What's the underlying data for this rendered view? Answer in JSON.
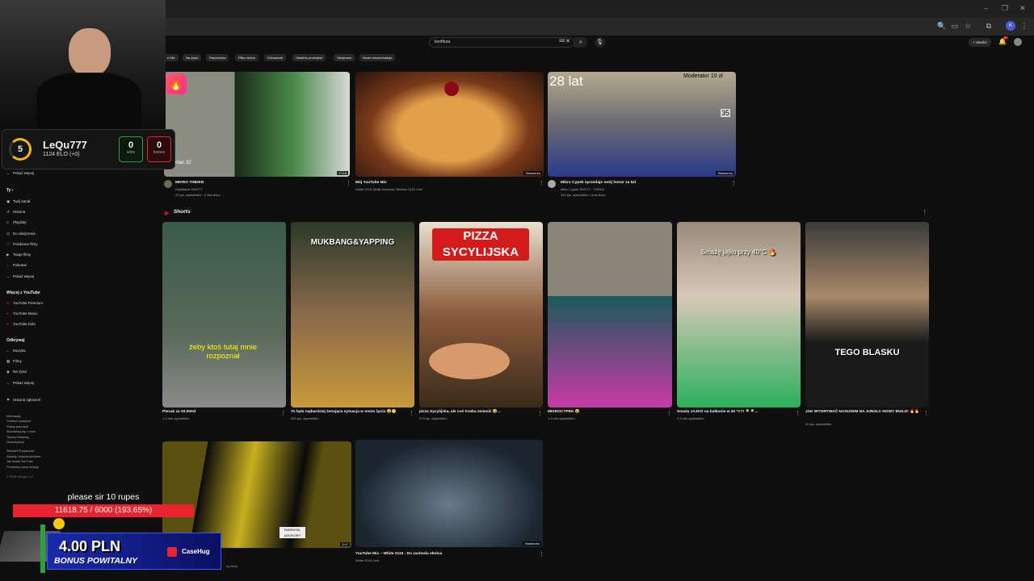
{
  "browser": {
    "title": "",
    "minimize": "–",
    "restore": "❐",
    "close": "✕",
    "profile_initial": "K"
  },
  "header": {
    "search_value": "konfitura",
    "create_label": "+ Utwórz",
    "notif_badge": "9+"
  },
  "chips": [
    "e Mix",
    "Na żywo",
    "Reprezenia",
    "Piłka nożna",
    "Gotowanie",
    "Ostatnio przesłane",
    "Obejrzane",
    "Nowe rekomendacje"
  ],
  "sidebar": {
    "show_more_1": "Pokaż więcej",
    "you_heading": "Ty  ›",
    "you_items": [
      {
        "icon": "▣",
        "label": "Twój kanał"
      },
      {
        "icon": "↺",
        "label": "Historia"
      },
      {
        "icon": "≡",
        "label": "Playlisty"
      },
      {
        "icon": "◷",
        "label": "Do obejrzenia"
      },
      {
        "icon": "♡",
        "label": "Polubione filmy"
      },
      {
        "icon": "▶",
        "label": "Twoje filmy"
      },
      {
        "icon": "↓",
        "label": "Pobrane"
      },
      {
        "icon": "⌄",
        "label": "Pokaż więcej"
      }
    ],
    "more_heading": "Więcej z YouTube",
    "more_items": [
      {
        "icon": "●",
        "label": "YouTube Premium"
      },
      {
        "icon": "●",
        "label": "YouTube Music"
      },
      {
        "icon": "●",
        "label": "YouTube Kids"
      }
    ],
    "explore_heading": "Odkrywaj",
    "explore_items": [
      {
        "icon": "♪",
        "label": "Muzyka"
      },
      {
        "icon": "▦",
        "label": "Filmy"
      },
      {
        "icon": "◉",
        "label": "Na żywo"
      },
      {
        "icon": "⌄",
        "label": "Pokaż więcej"
      }
    ],
    "history_item": {
      "icon": "⚑",
      "label": "Historia zgłoszeń"
    },
    "footer": [
      "Informacje",
      "Centrum prasowe",
      "Prawa autorskie",
      "Skontaktuj się z nami",
      "Twórcy  Reklamy",
      "Deweloperzy",
      "Warunki  Prywatność",
      "Zasady i bezpieczeństwo",
      "Jak działa YouTube",
      "Przetestuj nowe funkcje",
      "© 2025 Google LLC"
    ]
  },
  "top_videos": [
    {
      "title": "MIKRO TINDER",
      "channel": "Reptilianin SHOTY",
      "meta": "23 tys. wyświetleń • 2 lata temu",
      "overlay": "orlan 32",
      "duration": "17:18"
    },
    {
      "title": "Mój YouTube Mix",
      "channel": "White 2115, Malik Montana, Bedoes 2115 i inni",
      "meta": "",
      "overlay": "",
      "duration": "Składanka"
    },
    {
      "title": "Mikro Cypek sprzedaje swój honor za 5zł",
      "channel": "Mikro Cypek SHOTY · TERKA",
      "meta": "394 tys. wyświetleń • 6 lat temu",
      "overlay": "28 lat",
      "overlay2": "Moderator 10 zł",
      "overlay3": "35",
      "duration": "Składanka"
    }
  ],
  "shorts": {
    "heading": "Shorts",
    "items": [
      {
        "title": "Plecak za 20.000zł",
        "meta": "1,2 mln wyświetleń",
        "overlay": "żeby ktoś tutaj mnie rozpoznał"
      },
      {
        "title": "To była najbardziej żenująca sytuacja w moim życiu 😅😬",
        "meta": "343 tys. wyświetleń",
        "overlay": "MUKBANG&YAPPING"
      },
      {
        "title": "pizza Sycylijska, ale coś trzeba zmienić 😅...",
        "meta": "273 tys. wyświetleń",
        "overlay": "PIZZA SYCYLIJSKA"
      },
      {
        "title": "MIKROCYPEK 😂",
        "meta": "1,9 mln wyświetleń",
        "overlay": ""
      },
      {
        "title": "Smażę JAJKO na balkonie w 40 °C?! 🍳🍳...",
        "meta": "2,3 mln wyświetleń",
        "overlay": "Smażę jajko przy 40°C 🔥"
      },
      {
        "title": "JAK WYGRYWAĆ NASUSEM NA JUNGLI! NOWY BUILD! 🔥🔥",
        "meta": "32 tys. wyświetleń",
        "overlay": "TEGO BLASKU"
      }
    ]
  },
  "bottom_videos": [
    {
      "title": "",
      "meta": "",
      "duration": "3:47",
      "channel": "",
      "extra": "ny temu"
    },
    {
      "title": "YouTube Mix – White 2115 - Do zachodu słońca",
      "channel": "White 2115 i inni",
      "duration": "Składanka"
    }
  ],
  "elo_card": {
    "level": "5",
    "username": "LeQu777",
    "elo": "1124 ELO (+0)",
    "wins": "0",
    "wins_label": "wins",
    "losses": "0",
    "losses_label": "losses"
  },
  "donation": {
    "message": "please sir 10 rupes",
    "progress_text": "11618.75 / 6000 (193.65%)",
    "progress_percent": 100
  },
  "ad_banner": {
    "amount": "4.00 PLN",
    "tagline": "BONUS POWITALNY",
    "brand": "CaseHug"
  },
  "colors": {
    "accent_red": "#ff0033",
    "green": "#2ea043",
    "progress_red": "#e8232f"
  }
}
